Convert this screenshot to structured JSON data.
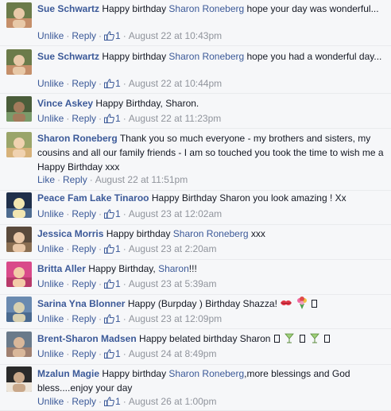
{
  "actions": {
    "unlike": "Unlike",
    "like": "Like",
    "reply": "Reply",
    "separator": "·"
  },
  "comments": [
    {
      "author": "Sue Schwartz",
      "text_before": "Happy birthday ",
      "mention": "Sharon Roneberg",
      "text_after": " hope your day was wonderful...",
      "likes": "1",
      "time": "August 22 at 10:43pm",
      "liked": true
    },
    {
      "author": "Sue Schwartz",
      "text_before": "Happy birthday ",
      "mention": "Sharon Roneberg",
      "text_after": " hope you had a wonderful day...",
      "likes": "1",
      "time": "August 22 at 10:44pm",
      "liked": true
    },
    {
      "author": "Vince Askey",
      "text_before": "Happy Birthday, Sharon.",
      "likes": "1",
      "time": "August 22 at 11:23pm",
      "liked": true
    },
    {
      "author": "Sharon Roneberg",
      "text_before": "Thank you so much everyone - my brothers and sisters, my cousins and all our family friends - I am so touched you took the time to wish me a Happy Birthday xxx",
      "time": "August 22 at 11:51pm",
      "liked": false
    },
    {
      "author": "Peace Fam Lake Tinaroo",
      "text_before": "Happy Birthday Sharon you look amazing ! Xx",
      "likes": "1",
      "time": "August 23 at 12:02am",
      "liked": true
    },
    {
      "author": "Jessica Morris",
      "text_before": "Happy birthday ",
      "mention": "Sharon Roneberg",
      "text_after": " xxx",
      "likes": "1",
      "time": "August 23 at 2:20am",
      "liked": true
    },
    {
      "author": "Britta Aller",
      "text_before": "Happy Birthday, ",
      "mention": "Sharon",
      "text_after": "!!!",
      "likes": "1",
      "time": "August 23 at 5:39am",
      "liked": true
    },
    {
      "author": "Sarina Yna Blonner",
      "text_before": "Happy (Burpday ) Birthday Shazza! ",
      "emoji": [
        "kiss-icon",
        "bouquet-icon",
        "box"
      ],
      "likes": "1",
      "time": "August 23 at 12:09pm",
      "liked": true
    },
    {
      "author": "Brent-Sharon Madsen",
      "text_before": "Happy belated birthday Sharon ",
      "emoji": [
        "box",
        "cocktail-icon",
        "box",
        "cocktail-icon",
        "box"
      ],
      "likes": "1",
      "time": "August 24 at 8:49pm",
      "liked": true
    },
    {
      "author": "Mzalun Magie",
      "text_before": "Happy birthday ",
      "mention": "Sharon Roneberg",
      "text_after": ",more blessings and God bless....enjoy your day",
      "likes": "1",
      "time": "August 26 at 1:00pm",
      "liked": true
    }
  ],
  "colors": {
    "link": "#3b5998",
    "meta": "#90949c",
    "background": "#f6f7f9"
  }
}
